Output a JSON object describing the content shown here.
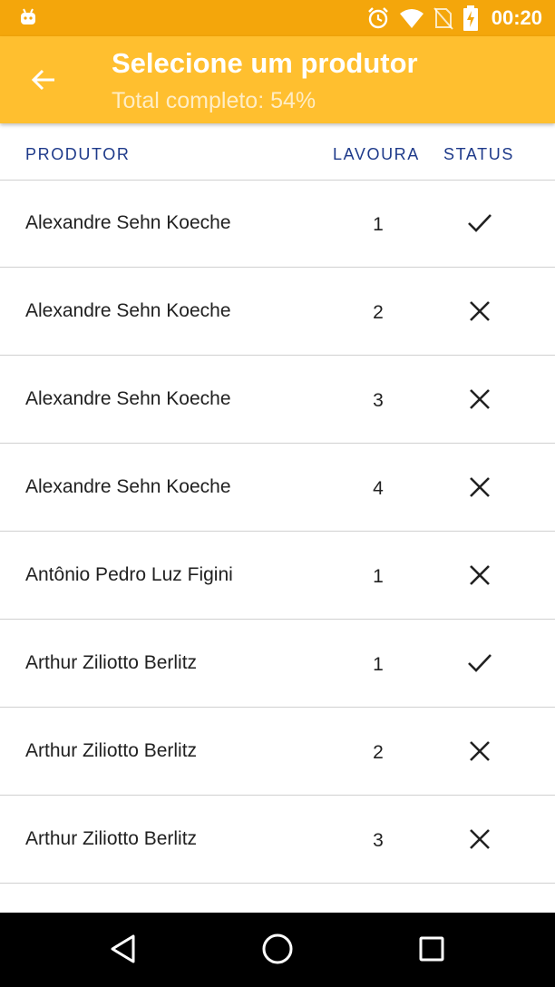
{
  "status_bar": {
    "time": "00:20",
    "icons": [
      "android-icon",
      "alarm-icon",
      "wifi-icon",
      "no-sim-icon",
      "battery-charging-icon"
    ]
  },
  "app_bar": {
    "title": "Selecione um produtor",
    "subtitle": "Total completo: 54%",
    "back_icon": "arrow-back-icon",
    "completion_percent": 54
  },
  "table": {
    "headers": {
      "produtor": "PRODUTOR",
      "lavoura": "LAVOURA",
      "status": "STATUS"
    },
    "rows": [
      {
        "produtor": "Alexandre Sehn Koeche",
        "lavoura": "1",
        "status": "done"
      },
      {
        "produtor": "Alexandre Sehn Koeche",
        "lavoura": "2",
        "status": "pending"
      },
      {
        "produtor": "Alexandre Sehn Koeche",
        "lavoura": "3",
        "status": "pending"
      },
      {
        "produtor": "Alexandre Sehn Koeche",
        "lavoura": "4",
        "status": "pending"
      },
      {
        "produtor": "Antônio Pedro Luz Figini",
        "lavoura": "1",
        "status": "pending"
      },
      {
        "produtor": "Arthur Ziliotto Berlitz",
        "lavoura": "1",
        "status": "done"
      },
      {
        "produtor": "Arthur Ziliotto Berlitz",
        "lavoura": "2",
        "status": "pending"
      },
      {
        "produtor": "Arthur Ziliotto Berlitz",
        "lavoura": "3",
        "status": "pending"
      }
    ]
  },
  "nav_bar": {
    "icons": [
      "back-triangle-icon",
      "home-circle-icon",
      "recents-square-icon"
    ]
  },
  "colors": {
    "status_bar": "#F4A60B",
    "app_bar": "#FFBF2F",
    "header_text": "#1E3A8A"
  }
}
